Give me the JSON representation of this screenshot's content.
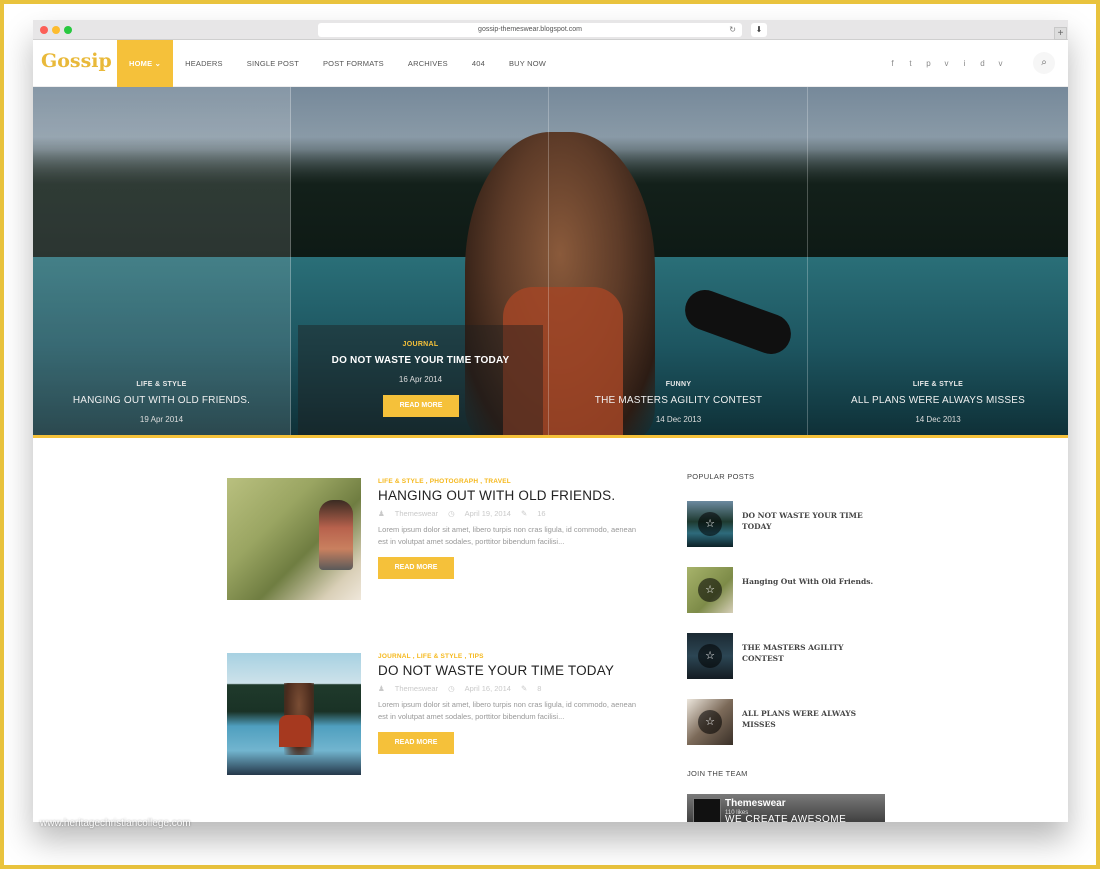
{
  "browser": {
    "url": "gossip-themeswear.blogspot.com",
    "new_tab_label": "+"
  },
  "site": {
    "logo": "Gossip",
    "accent_color": "#f5c13a"
  },
  "nav": {
    "items": [
      {
        "label": "HOME",
        "active": true
      },
      {
        "label": "HEADERS"
      },
      {
        "label": "SINGLE POST"
      },
      {
        "label": "POST FORMATS"
      },
      {
        "label": "ARCHIVES"
      },
      {
        "label": "404"
      },
      {
        "label": "BUY NOW"
      }
    ],
    "home_chevron": "⌄"
  },
  "socials": [
    "f",
    "t",
    "p",
    "v",
    "i",
    "d",
    "v"
  ],
  "slider": {
    "slides": [
      {
        "category": "LIFE & STYLE",
        "title": "HANGING OUT WITH OLD FRIENDS.",
        "date": "19 Apr 2014"
      },
      {
        "category": "JOURNAL",
        "title": "DO NOT WASTE YOUR TIME TODAY",
        "date": "16 Apr 2014",
        "button": "READ MORE"
      },
      {
        "category": "FUNNY",
        "title": "THE MASTERS AGILITY CONTEST",
        "date": "14 Dec 2013"
      },
      {
        "category": "LIFE & STYLE",
        "title": "ALL PLANS WERE ALWAYS MISSES",
        "date": "14 Dec 2013"
      }
    ]
  },
  "posts": [
    {
      "categories": "LIFE & STYLE , PHOTOGRAPH , TRAVEL",
      "title": "HANGING OUT WITH OLD FRIENDS.",
      "author": "Themeswear",
      "date": "April 19, 2014",
      "comments": "16",
      "excerpt": "Lorem ipsum dolor sit amet, libero turpis non cras ligula, id commodo, aenean est in volutpat amet sodales, porttitor bibendum facilisi...",
      "button": "READ MORE"
    },
    {
      "categories": "JOURNAL , LIFE & STYLE , TIPS",
      "title": "DO NOT WASTE YOUR TIME TODAY",
      "author": "Themeswear",
      "date": "April 16, 2014",
      "comments": "8",
      "excerpt": "Lorem ipsum dolor sit amet, libero turpis non cras ligula, id commodo, aenean est in volutpat amet sodales, porttitor bibendum facilisi...",
      "button": "READ MORE"
    }
  ],
  "sidebar": {
    "popular_heading": "POPULAR POSTS",
    "popular": [
      {
        "title": "DO NOT WASTE YOUR TIME TODAY"
      },
      {
        "title": "Hanging Out With Old Friends."
      },
      {
        "title": "THE MASTERS AGILITY CONTEST"
      },
      {
        "title": "ALL PLANS WERE ALWAYS MISSES"
      }
    ],
    "team_heading": "JOIN THE TEAM",
    "team": {
      "name": "Themeswear",
      "sub": "110 likes",
      "slogan": "WE CREATE AWESOME"
    }
  },
  "watermark": "www.heritagechristiancollege.com"
}
